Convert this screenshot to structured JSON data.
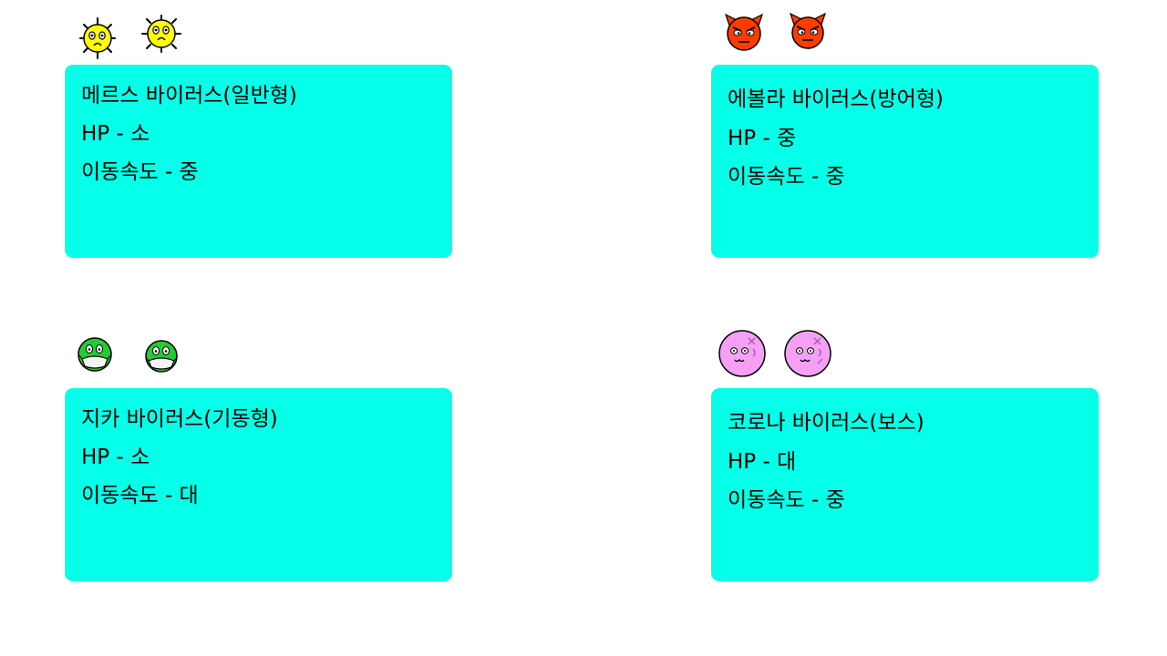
{
  "viruses": [
    {
      "id": "meres",
      "name": "메르스 바이러스(일반형)",
      "hp": "HP - 소",
      "speed": "이동속도 - 중",
      "sprite": "yellow-spiky-virus-icon",
      "color": "#ffff00"
    },
    {
      "id": "ebola",
      "name": "에볼라 바이러스(방어형)",
      "hp": "HP - 중",
      "speed": "이동속도 - 중",
      "sprite": "red-devil-virus-icon",
      "color": "#ff3c00"
    },
    {
      "id": "zika",
      "name": "지카 바이러스(기동형)",
      "hp": "HP - 소",
      "speed": "이동속도 - 대",
      "sprite": "green-masked-virus-icon",
      "color": "#22cc33"
    },
    {
      "id": "corona",
      "name": "코로나 바이러스(보스)",
      "hp": "HP - 대",
      "speed": "이동속도 - 중",
      "sprite": "pink-round-virus-icon",
      "color": "#f5a0f5"
    }
  ],
  "theme": {
    "card_color": "#06ffe8",
    "background": "#ffffff"
  }
}
